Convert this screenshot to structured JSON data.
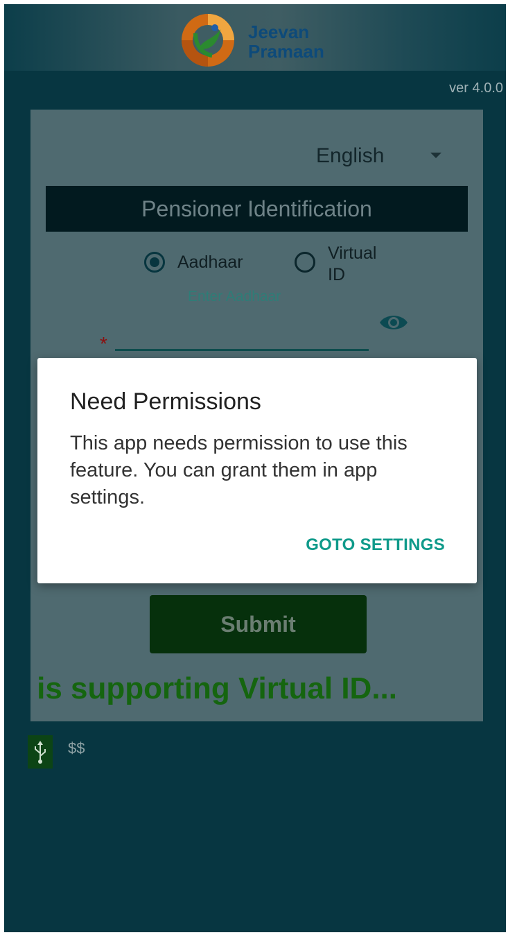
{
  "header": {
    "brand_line1": "Jeevan",
    "brand_line2": "Pramaan",
    "logo_icon": "jeevan-pramaan-logo"
  },
  "version": "ver 4.0.0",
  "language": {
    "selected": "English"
  },
  "section_title": "Pensioner Identification",
  "id_type": {
    "options": [
      {
        "label": "Aadhaar",
        "selected": true
      },
      {
        "label": "Virtual\nID",
        "selected": false
      }
    ]
  },
  "aadhaar_input": {
    "label": "Enter Aadhaar",
    "value": "",
    "required_mark": "*",
    "toggle_icon": "eye-icon"
  },
  "submit_label": "Submit",
  "marquee_text": "n is supporting Virtual ID...",
  "footer": {
    "status_text": "$$",
    "icon": "usb-icon"
  },
  "dialog": {
    "title": "Need Permissions",
    "message": "This app needs permission to use this feature. You can grant them in app settings.",
    "action": "GOTO SETTINGS"
  },
  "colors": {
    "background": "#073641",
    "accent": "#0f9a8a",
    "submit": "#06300c",
    "marquee": "#15650f"
  }
}
